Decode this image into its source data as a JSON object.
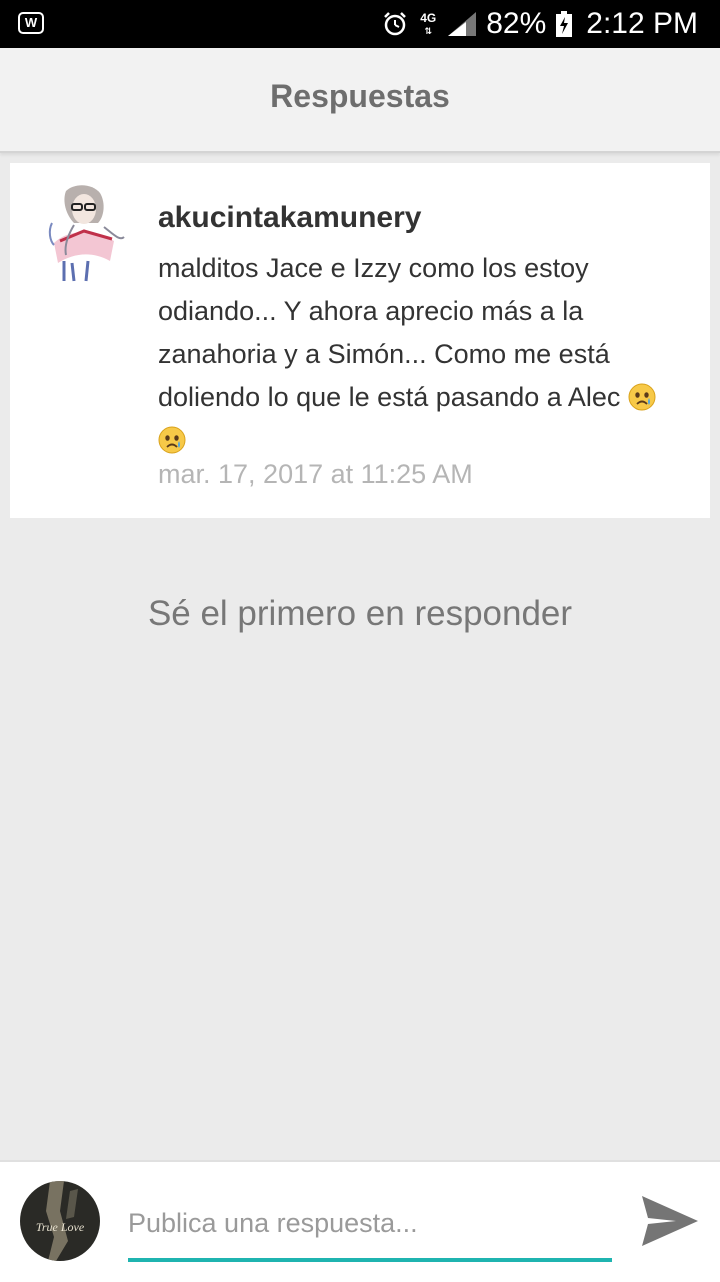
{
  "status_bar": {
    "network": "4G",
    "battery_percent": "82%",
    "time": "2:12 PM"
  },
  "header": {
    "title": "Respuestas"
  },
  "comment": {
    "username": "akucintakamunery",
    "text": "malditos Jace e Izzy como los estoy odiando... Y ahora aprecio más a la zanahoria y a Simón... Como me está doliendo lo que le está pasando a Alec ",
    "emojis": [
      "crying-face-icon",
      "crying-face-icon"
    ],
    "timestamp": "mar. 17, 2017 at 11:25 AM"
  },
  "empty_state": {
    "message": "Sé el primero en responder"
  },
  "reply_bar": {
    "avatar_text": "True Love",
    "placeholder": "Publica una respuesta...",
    "accent_color": "#1fb4b0"
  }
}
